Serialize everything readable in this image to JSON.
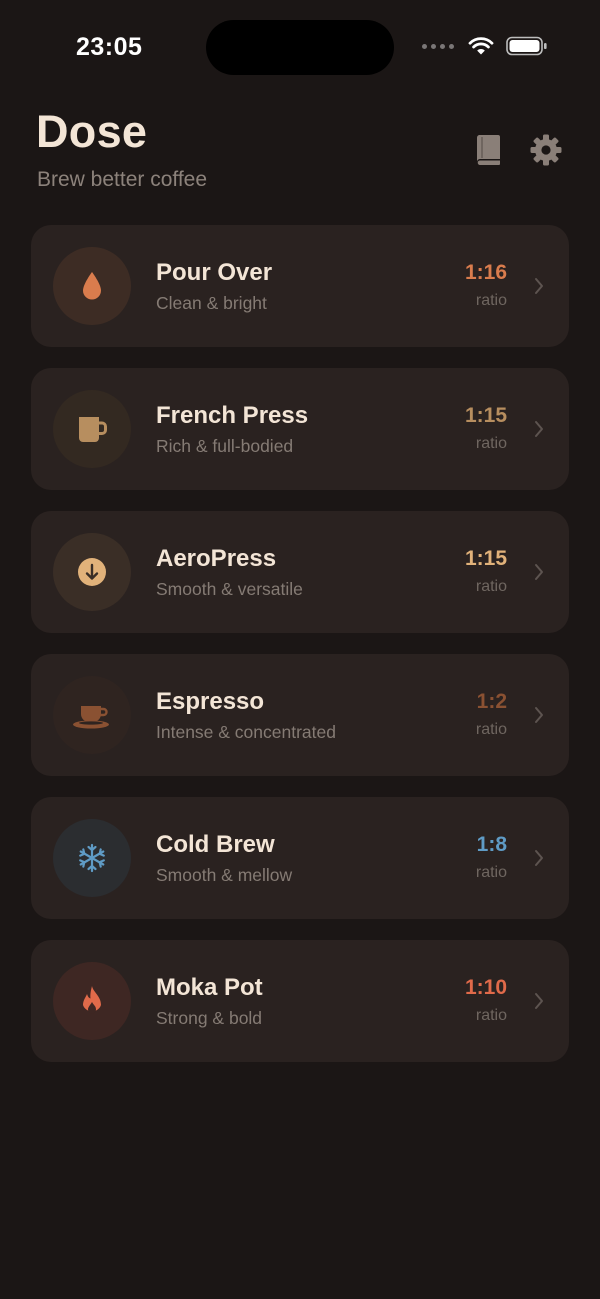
{
  "status_bar": {
    "time": "23:05"
  },
  "header": {
    "title": "Dose",
    "subtitle": "Brew better coffee",
    "library_icon": "book-icon",
    "settings_icon": "gear-icon"
  },
  "methods": [
    {
      "name": "Pour Over",
      "description": "Clean & bright",
      "ratio": "1:16",
      "ratio_label": "ratio",
      "icon": "drop-icon",
      "accent": "#d97c4d",
      "icon_bg": "#3d2c24"
    },
    {
      "name": "French Press",
      "description": "Rich & full-bodied",
      "ratio": "1:15",
      "ratio_label": "ratio",
      "icon": "mug-icon",
      "accent": "#b78e5f",
      "icon_bg": "#332921"
    },
    {
      "name": "AeroPress",
      "description": "Smooth & versatile",
      "ratio": "1:15",
      "ratio_label": "ratio",
      "icon": "arrow-down-circle-icon",
      "accent": "#e1b27a",
      "icon_bg": "#3a2e26"
    },
    {
      "name": "Espresso",
      "description": "Intense & concentrated",
      "ratio": "1:2",
      "ratio_label": "ratio",
      "icon": "espresso-cup-icon",
      "accent": "#8a5132",
      "icon_bg": "#2f2420"
    },
    {
      "name": "Cold Brew",
      "description": "Smooth & mellow",
      "ratio": "1:8",
      "ratio_label": "ratio",
      "icon": "snowflake-icon",
      "accent": "#5f9bc5",
      "icon_bg": "#2b2d30"
    },
    {
      "name": "Moka Pot",
      "description": "Strong & bold",
      "ratio": "1:10",
      "ratio_label": "ratio",
      "icon": "flame-icon",
      "accent": "#e06a4a",
      "icon_bg": "#3e2723"
    }
  ]
}
